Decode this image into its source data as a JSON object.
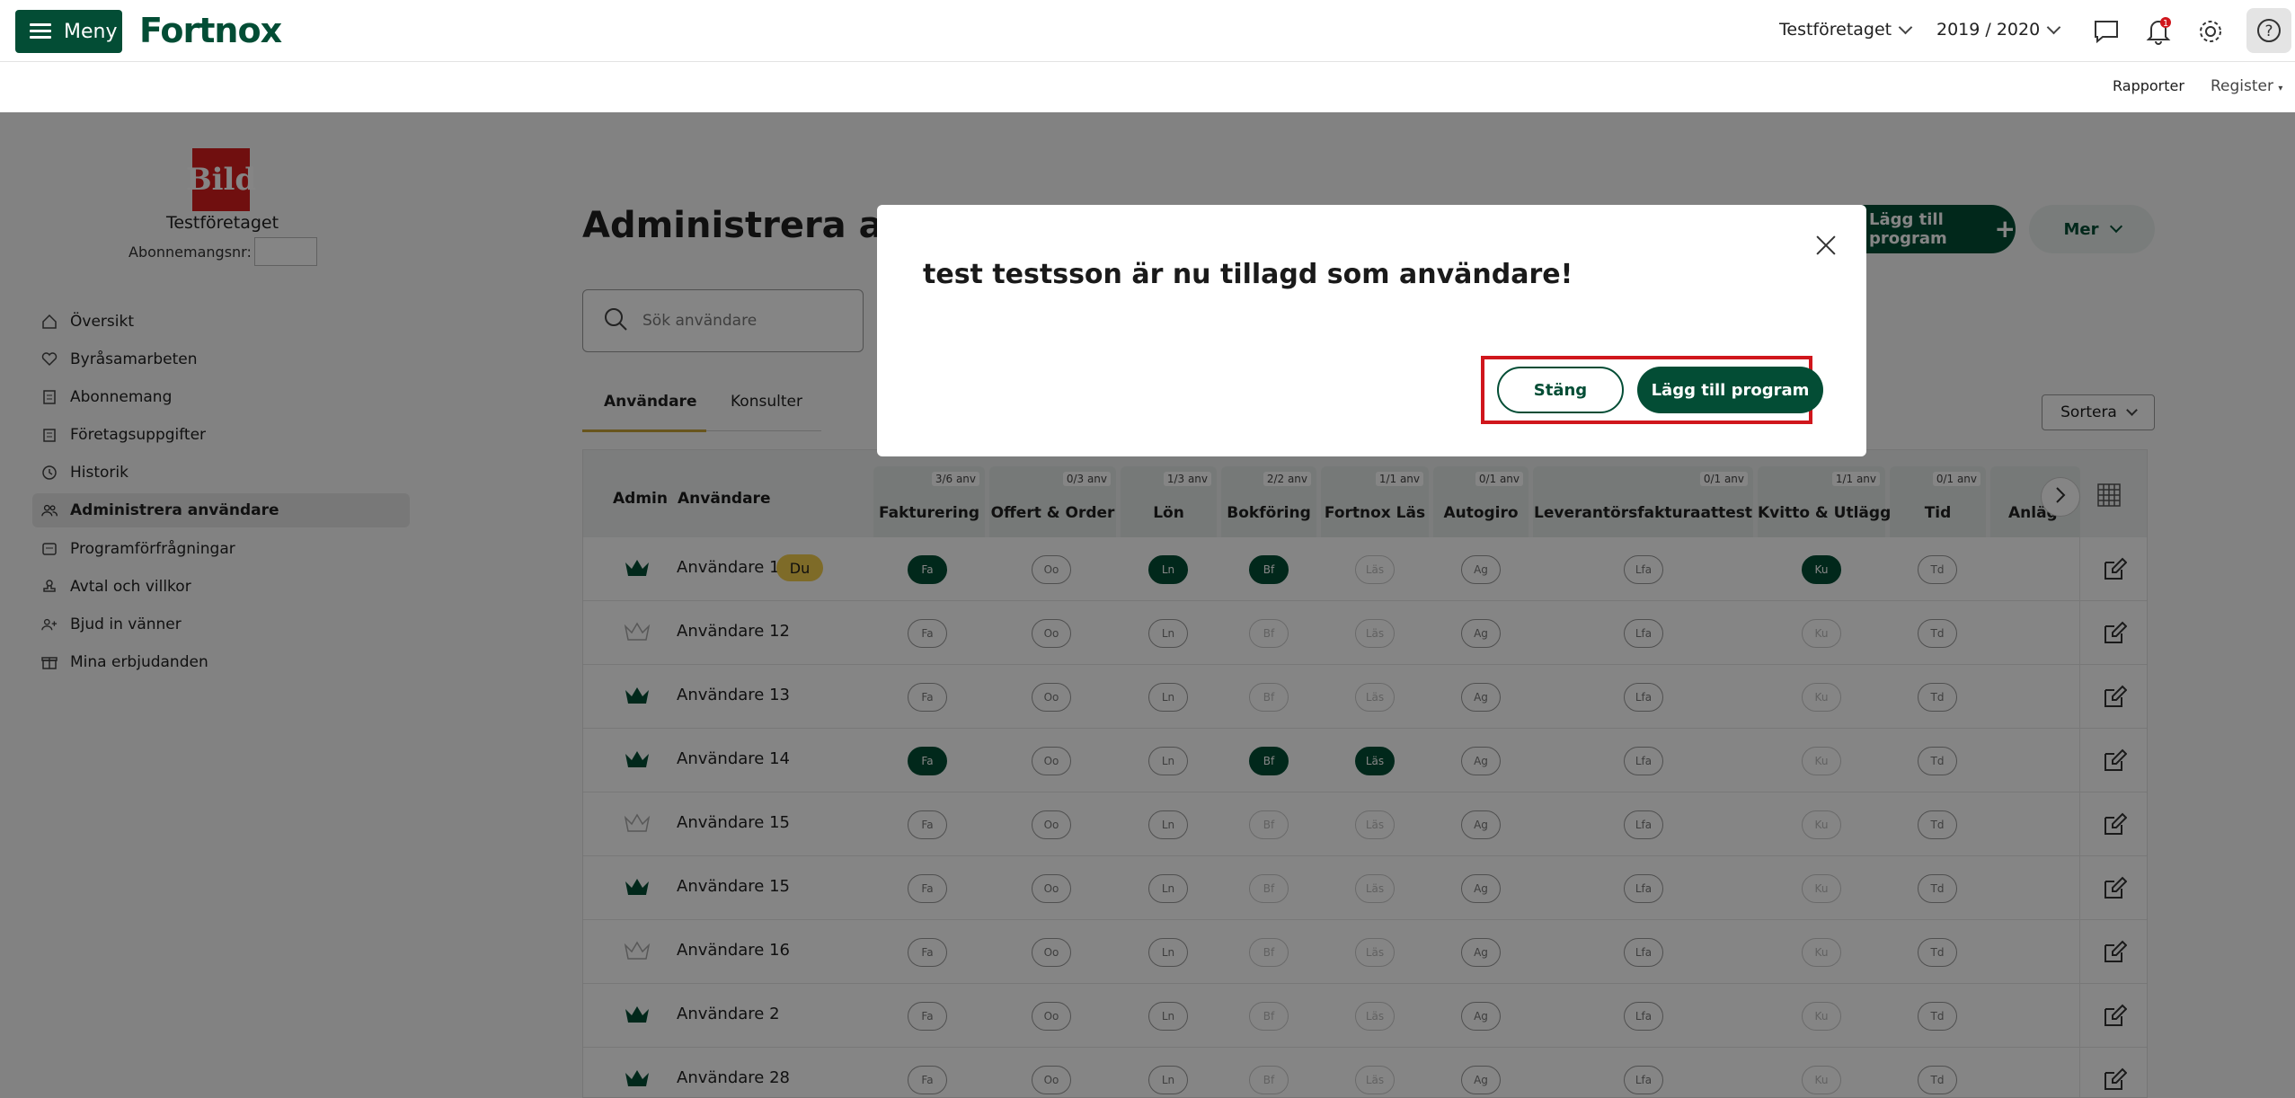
{
  "header": {
    "menu_label": "Meny",
    "logo_text": "Fortnox",
    "company": "Testföretaget",
    "year": "2019 / 2020",
    "notification_count": "1"
  },
  "subnav": {
    "rapporter": "Rapporter",
    "register": "Register"
  },
  "sidebar": {
    "company_logo_text": "Bild",
    "company_name": "Testföretaget",
    "subscription_label": "Abonnemangsnr:",
    "items": [
      {
        "label": "Översikt",
        "icon": "home-icon"
      },
      {
        "label": "Byråsamarbeten",
        "icon": "heart-icon"
      },
      {
        "label": "Abonnemang",
        "icon": "document-icon"
      },
      {
        "label": "Företagsuppgifter",
        "icon": "building-icon"
      },
      {
        "label": "Historik",
        "icon": "history-icon"
      },
      {
        "label": "Administrera användare",
        "icon": "users-icon",
        "active": true
      },
      {
        "label": "Programförfrågningar",
        "icon": "request-icon"
      },
      {
        "label": "Avtal och villkor",
        "icon": "stamp-icon"
      },
      {
        "label": "Bjud in vänner",
        "icon": "invite-icon"
      },
      {
        "label": "Mina erbjudanden",
        "icon": "gift-icon"
      }
    ]
  },
  "main": {
    "title": "Administrera anv",
    "add_program_label": "Lägg till program",
    "more_label": "Mer",
    "search_placeholder": "Sök användare",
    "tabs": [
      "Användare",
      "Konsulter"
    ],
    "sort_label": "Sortera",
    "table": {
      "admin_header": "Admin",
      "user_header": "Användare",
      "columns": [
        {
          "name": "Fakturering",
          "count": "3/6 anv",
          "abbr": "Fa"
        },
        {
          "name": "Offert & Order",
          "count": "0/3 anv",
          "abbr": "Oo"
        },
        {
          "name": "Lön",
          "count": "1/3 anv",
          "abbr": "Ln"
        },
        {
          "name": "Bokföring",
          "count": "2/2 anv",
          "abbr": "Bf"
        },
        {
          "name": "Fortnox Läs",
          "count": "1/1 anv",
          "abbr": "Läs"
        },
        {
          "name": "Autogiro",
          "count": "0/1 anv",
          "abbr": "Ag"
        },
        {
          "name": "Leverantörsfakturaattest",
          "count": "0/1 anv",
          "abbr": "Lfa"
        },
        {
          "name": "Kvitto & Utlägg",
          "count": "1/1 anv",
          "abbr": "Ku"
        },
        {
          "name": "Tid",
          "count": "0/1 anv",
          "abbr": "Td"
        },
        {
          "name": "Anläg",
          "count": "",
          "abbr": ""
        }
      ],
      "you_badge": "Du",
      "rows": [
        {
          "name": "Användare 1",
          "admin": true,
          "you": true,
          "on": [
            "Fa",
            "Ln",
            "Bf",
            "Ku"
          ]
        },
        {
          "name": "Användare 12",
          "admin": false,
          "on": []
        },
        {
          "name": "Användare 13",
          "admin": true,
          "on": []
        },
        {
          "name": "Användare 14",
          "admin": true,
          "on": [
            "Fa",
            "Bf",
            "Läs"
          ]
        },
        {
          "name": "Användare 15",
          "admin": false,
          "on": []
        },
        {
          "name": "Användare 15",
          "admin": true,
          "on": []
        },
        {
          "name": "Användare 16",
          "admin": false,
          "on": []
        },
        {
          "name": "Användare 2",
          "admin": true,
          "on": []
        },
        {
          "name": "Användare 28",
          "admin": true,
          "on": []
        }
      ]
    }
  },
  "modal": {
    "message": "test testsson är nu tillagd som användare!",
    "close_label": "Stäng",
    "add_program_label": "Lägg till program"
  },
  "colors": {
    "brand": "#034d35",
    "highlight": "#d0161c",
    "badge": "#f2cd4d"
  }
}
